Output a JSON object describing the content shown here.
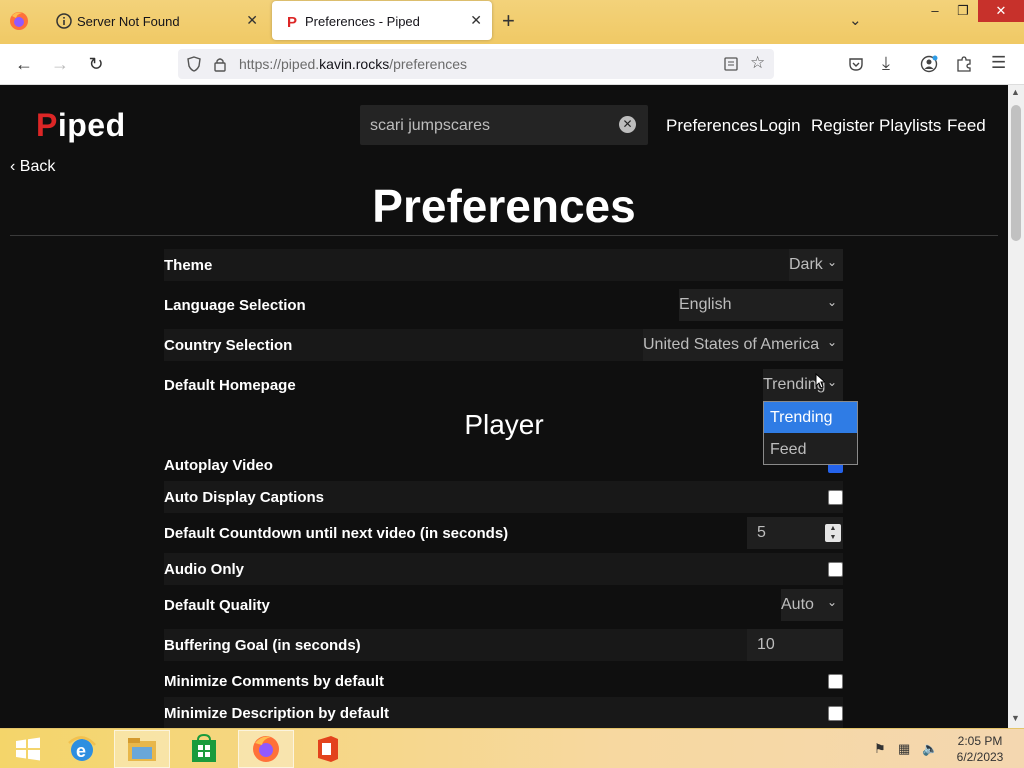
{
  "browser": {
    "tabs": [
      {
        "title": "Server Not Found",
        "active": false
      },
      {
        "title": "Preferences - Piped",
        "active": true
      }
    ],
    "url_prefix": "https://piped.",
    "url_domain": "kavin.rocks",
    "url_path": "/preferences",
    "win_controls": {
      "minimize": "–",
      "restore": "❐",
      "close": "✕"
    }
  },
  "header": {
    "logo_first": "P",
    "logo_rest": "iped",
    "search_value": "scari jumpscares",
    "nav": [
      "Preferences",
      "Login",
      "Register",
      "Playlists",
      "Feed"
    ],
    "back": "Back"
  },
  "page_title": "Preferences",
  "settings": [
    {
      "label": "Theme",
      "value": "Dark",
      "kind": "select"
    },
    {
      "label": "Language Selection",
      "value": "English",
      "kind": "select"
    },
    {
      "label": "Country Selection",
      "value": "United States of America",
      "kind": "select"
    },
    {
      "label": "Default Homepage",
      "value": "Trending",
      "kind": "select"
    }
  ],
  "player_section": "Player",
  "player_settings": [
    {
      "label": "Autoplay Video",
      "kind": "checkbox",
      "checked": true
    },
    {
      "label": "Auto Display Captions",
      "kind": "checkbox",
      "checked": false
    },
    {
      "label": "Default Countdown until next video (in seconds)",
      "kind": "number",
      "value": "5"
    },
    {
      "label": "Audio Only",
      "kind": "checkbox",
      "checked": false
    },
    {
      "label": "Default Quality",
      "kind": "select",
      "value": "Auto"
    },
    {
      "label": "Buffering Goal (in seconds)",
      "kind": "number",
      "value": "10"
    },
    {
      "label": "Minimize Comments by default",
      "kind": "checkbox",
      "checked": false
    },
    {
      "label": "Minimize Description by default",
      "kind": "checkbox",
      "checked": false
    }
  ],
  "homepage_dropdown": {
    "options": [
      "Trending",
      "Feed"
    ],
    "selected": "Trending"
  },
  "colors": {
    "accent_red": "#dc2626",
    "dropdown_highlight": "#2f7ce5",
    "page_bg": "#0f0f0f"
  },
  "taskbar": {
    "apps": [
      "windows-start-icon",
      "internet-explorer-icon",
      "file-explorer-icon",
      "store-icon",
      "firefox-icon",
      "office-icon"
    ],
    "time": "2:05 PM",
    "date": "6/2/2023"
  }
}
